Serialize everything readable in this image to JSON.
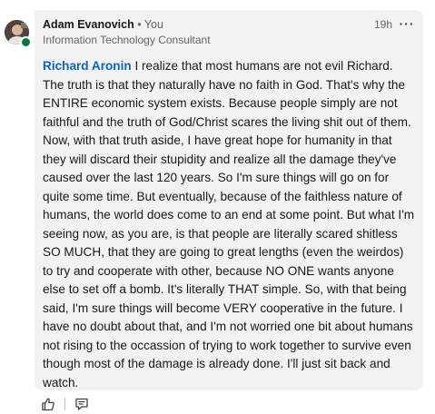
{
  "comment": {
    "author_name": "Adam Evanovich",
    "degree": "• You",
    "headline": "Information Technology Consultant",
    "timestamp": "19h",
    "more_label": "···",
    "mention": "Richard Aronin",
    "text": "I realize that most humans are not evil Richard.  The truth is that they naturally have no faith in God.  That's why the ENTIRE economic system exists.  Because people simply are not faithful and the truth of God/Christ scares the living shit out of them.  Now, with that truth aside, I have great hope for humanity in that they will discard their stupidity and realize all the damage they've caused over the last 120 years.  So I'm sure things will go on for quite some time.  But eventually, because of the faithless nature of humans, the world does come to an end at some point.  But what I'm seeing now, as you are, is that people are literally scared shitless SO MUCH, that they are going to great lengths (even the weirdos) to try and cooperate with other, because NO ONE wants anyone else to set off a bomb.  It's literally THAT simple.  So, with that being said, I'm sure things will become VERY cooperative in the future.  I have no doubt about that, and I'm not worried one bit about humans not rising to the occassion of trying to work together to survive even though most of the damage is already done.  I'll just sit back and watch."
  },
  "actions": {
    "like_icon": "thumbs-up-icon",
    "reply_icon": "comment-icon"
  },
  "colors": {
    "bubble": "#f2f2f2",
    "mention": "#0a66c2",
    "presence": "#057642"
  }
}
